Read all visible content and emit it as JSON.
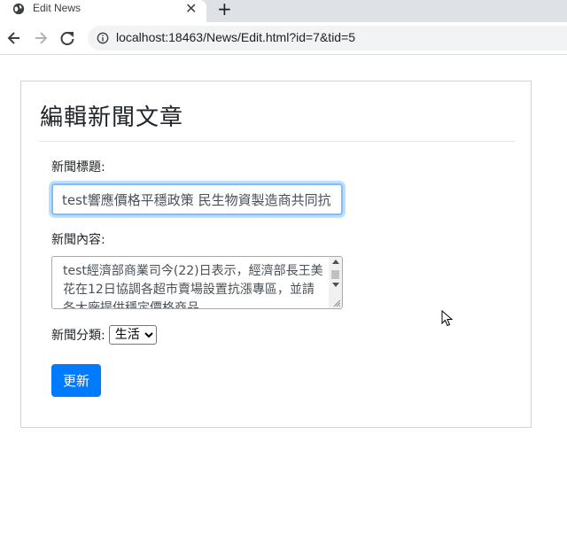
{
  "browser": {
    "tab_title": "Edit News",
    "tab_close": "✕",
    "new_tab": "+",
    "url": "localhost:18463/News/Edit.html?id=7&tid=5"
  },
  "form": {
    "heading": "編輯新聞文章",
    "title_label": "新聞標題:",
    "title_value": "test響應價格平穩政策 民生物資製造商共同抗",
    "content_label": "新聞內容:",
    "content_value": "test經濟部商業司今(22)日表示，經濟部長王美花在12日協調各超市賣場設置抗漲專區，並請各大廠提供穩定價格商品",
    "category_label": "新聞分類:",
    "category_selected": "生活",
    "submit_label": "更新"
  },
  "colors": {
    "primary": "#007bff",
    "focus_border": "#80bdff",
    "tabstrip": "#dee1e6"
  }
}
